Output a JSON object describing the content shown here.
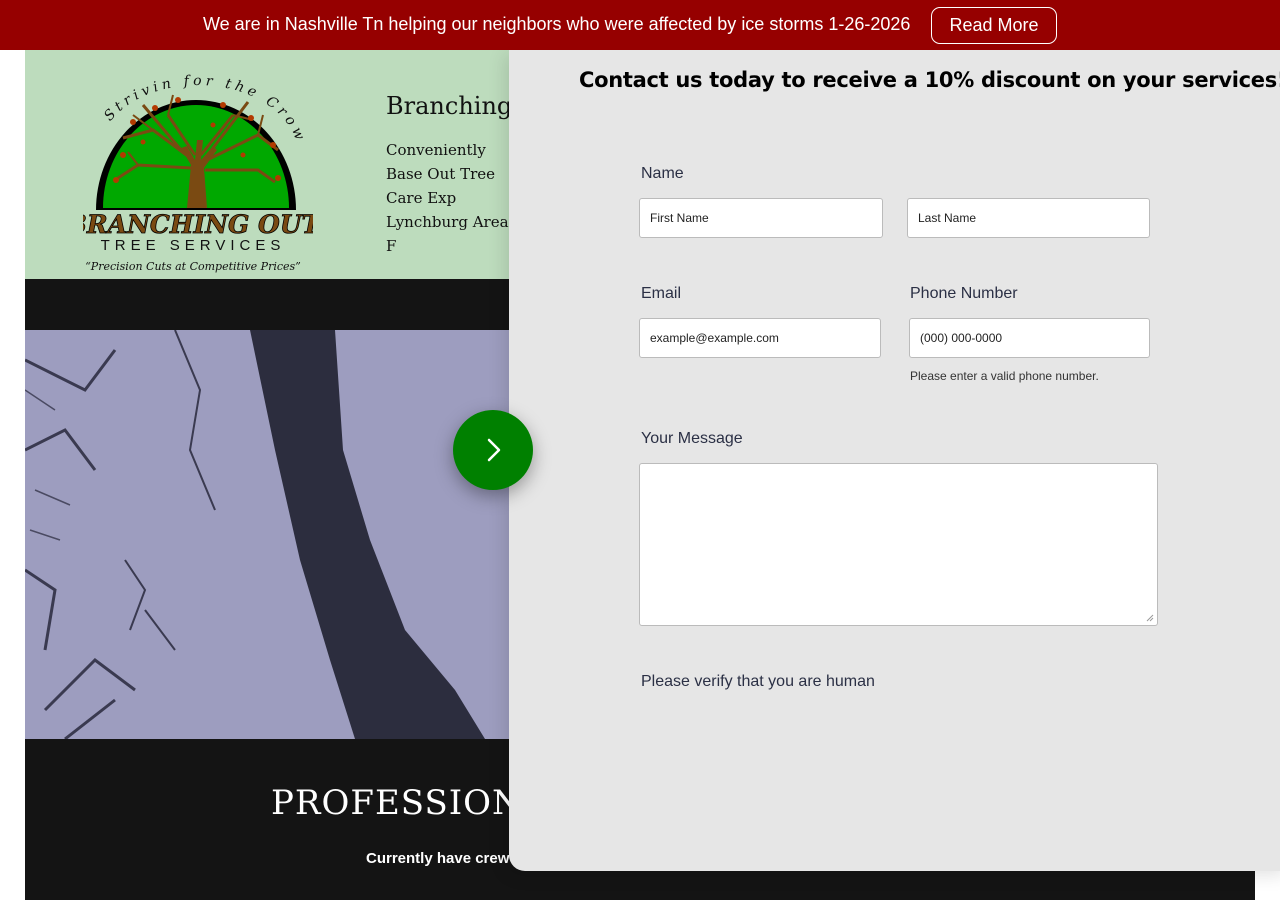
{
  "announcement": {
    "text": "We are in Nashville Tn helping our neighbors who were affected by ice storms 1-26-2026",
    "button_label": "Read More",
    "background_color": "#960000"
  },
  "header": {
    "logo": {
      "arc_text": "Strivin for the Crown",
      "name": "BRANCHING OUT",
      "subname": "TREE SERVICES",
      "tagline": "“Precision Cuts at Competitive Prices”"
    },
    "title": "Branching O",
    "description": "Conveniently Base Out Tree Care Exp Lynchburg Area F",
    "background_color": "#bddcbd"
  },
  "hero": {
    "heading": "PROFESSIONA",
    "subtext": "Currently have crew i",
    "next_icon": "chevron-right-icon",
    "next_button_color": "#008000"
  },
  "contact_panel": {
    "title": "Contact us today to receive a 10% discount on your services!",
    "name_label": "Name",
    "first_name_placeholder": "First Name",
    "last_name_placeholder": "Last Name",
    "email_label": "Email",
    "email_placeholder": "example@example.com",
    "phone_label": "Phone Number",
    "phone_placeholder": "(000) 000-0000",
    "phone_hint": "Please enter a valid phone number.",
    "message_label": "Your Message",
    "verify_label": "Please verify that you are human"
  }
}
